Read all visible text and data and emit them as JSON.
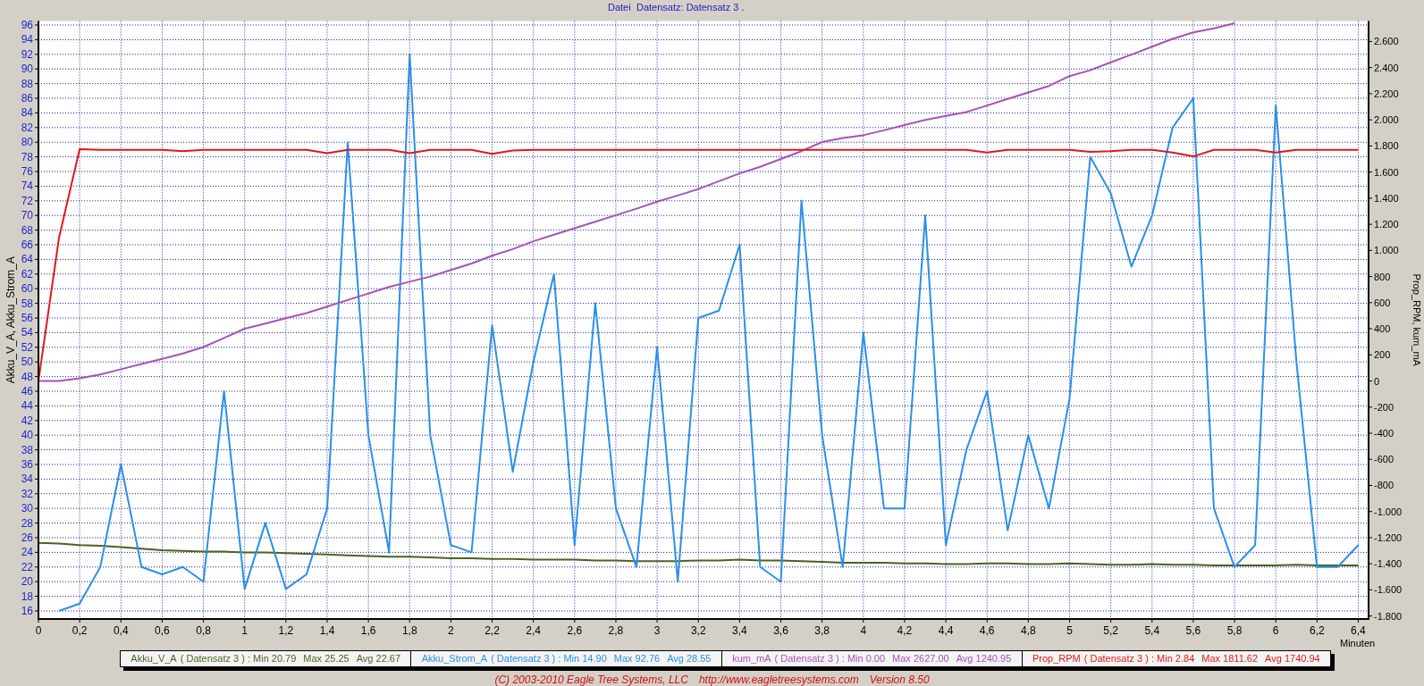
{
  "header": {
    "menu": "Datei",
    "title": "Datensatz: Datensatz 3 ."
  },
  "chart": {
    "chart_data": {
      "type": "line",
      "grid": true,
      "xlabel": "Minuten",
      "ylabel": "Akku_V_A, Akku_Strom_A",
      "y2label": "Prop_RPM, kum_mA",
      "xlim": [
        0,
        6.45
      ],
      "ylim": [
        14.9,
        96.55
      ],
      "y2lim": [
        -1823,
        2757
      ],
      "xticks": [
        0,
        {
          "value": 0.2,
          "label": "0,2"
        },
        {
          "value": 0.4,
          "label": "0,4"
        },
        {
          "value": 0.6,
          "label": "0,6"
        },
        {
          "value": 0.8,
          "label": "0,8"
        },
        1,
        {
          "value": 1.2,
          "label": "1,2"
        },
        {
          "value": 1.4,
          "label": "1,4"
        },
        {
          "value": 1.6,
          "label": "1,6"
        },
        {
          "value": 1.8,
          "label": "1,8"
        },
        2,
        {
          "value": 2.2,
          "label": "2,2"
        },
        {
          "value": 2.4,
          "label": "2,4"
        },
        {
          "value": 2.6,
          "label": "2,6"
        },
        {
          "value": 2.8,
          "label": "2,8"
        },
        3,
        {
          "value": 3.2,
          "label": "3,2"
        },
        {
          "value": 3.4,
          "label": "3,4"
        },
        {
          "value": 3.6,
          "label": "3,6"
        },
        {
          "value": 3.8,
          "label": "3,8"
        },
        4,
        {
          "value": 4.2,
          "label": "4,2"
        },
        {
          "value": 4.4,
          "label": "4,4"
        },
        {
          "value": 4.6,
          "label": "4,6"
        },
        {
          "value": 4.8,
          "label": "4,8"
        },
        5,
        {
          "value": 5.2,
          "label": "5,2"
        },
        {
          "value": 5.4,
          "label": "5,4"
        },
        {
          "value": 5.6,
          "label": "5,6"
        },
        {
          "value": 5.8,
          "label": "5,8"
        },
        6,
        {
          "value": 6.2,
          "label": "6,2"
        },
        {
          "value": 6.4,
          "label": "6,4"
        }
      ],
      "yticks": [
        16,
        18,
        20,
        22,
        24,
        26,
        28,
        30,
        32,
        34,
        36,
        38,
        40,
        42,
        44,
        46,
        48,
        50,
        52,
        54,
        56,
        58,
        60,
        62,
        64,
        66,
        68,
        70,
        72,
        74,
        76,
        78,
        80,
        82,
        84,
        86,
        88,
        90,
        92,
        94,
        96
      ],
      "y2ticks": [
        {
          "value": -1800,
          "label": "-1.800"
        },
        {
          "value": -1600,
          "label": "-1.600"
        },
        {
          "value": -1400,
          "label": "-1.400"
        },
        {
          "value": -1200,
          "label": "-1.200"
        },
        {
          "value": -1000,
          "label": "-1.000"
        },
        -800,
        -600,
        -400,
        -200,
        0,
        200,
        400,
        600,
        800,
        {
          "value": 1000,
          "label": "1.000"
        },
        {
          "value": 1200,
          "label": "1.200"
        },
        {
          "value": 1400,
          "label": "1.400"
        },
        {
          "value": 1600,
          "label": "1.600"
        },
        {
          "value": 1800,
          "label": "1.800"
        },
        {
          "value": 2000,
          "label": "2.000"
        },
        {
          "value": 2200,
          "label": "2.200"
        },
        {
          "value": 2400,
          "label": "2.400"
        },
        {
          "value": 2600,
          "label": "2.600"
        }
      ],
      "x": [
        0,
        0.1,
        0.2,
        0.3,
        0.4,
        0.5,
        0.6,
        0.7,
        0.8,
        0.9,
        1.0,
        1.1,
        1.2,
        1.3,
        1.4,
        1.5,
        1.6,
        1.7,
        1.8,
        1.9,
        2.0,
        2.1,
        2.2,
        2.3,
        2.4,
        2.5,
        2.6,
        2.7,
        2.8,
        2.9,
        3.0,
        3.1,
        3.2,
        3.3,
        3.4,
        3.5,
        3.6,
        3.7,
        3.8,
        3.9,
        4.0,
        4.1,
        4.2,
        4.3,
        4.4,
        4.5,
        4.6,
        4.7,
        4.8,
        4.9,
        5.0,
        5.1,
        5.2,
        5.3,
        5.4,
        5.5,
        5.6,
        5.7,
        5.8,
        5.9,
        6.0,
        6.1,
        6.2,
        6.3,
        6.4
      ],
      "series": [
        {
          "name": "Akku_V_A",
          "color": "#4a6320",
          "values": [
            25.3,
            25.2,
            25.0,
            24.9,
            24.7,
            24.5,
            24.3,
            24.2,
            24.1,
            24.1,
            24.0,
            24.0,
            23.9,
            23.8,
            23.7,
            23.6,
            23.5,
            23.4,
            23.4,
            23.3,
            23.2,
            23.2,
            23.1,
            23.1,
            23.0,
            23.0,
            23.0,
            22.9,
            22.9,
            22.8,
            22.8,
            22.8,
            22.9,
            22.9,
            23.0,
            22.9,
            22.9,
            22.8,
            22.7,
            22.6,
            22.6,
            22.6,
            22.5,
            22.5,
            22.4,
            22.4,
            22.5,
            22.5,
            22.4,
            22.4,
            22.5,
            22.4,
            22.3,
            22.3,
            22.4,
            22.3,
            22.3,
            22.2,
            22.2,
            22.2,
            22.2,
            22.3,
            22.2,
            22.2,
            22.2
          ]
        },
        {
          "name": "Akku_Strom_A",
          "color": "#2b8fe8",
          "values": [
            null,
            16,
            17,
            22,
            36,
            22,
            21,
            22,
            20,
            46,
            19,
            28,
            19,
            21,
            30,
            80,
            40,
            24,
            92,
            40,
            25,
            24,
            55,
            35,
            50,
            62,
            25,
            58,
            30,
            22,
            52,
            20,
            56,
            57,
            66,
            22,
            20,
            72,
            40,
            22,
            54,
            30,
            30,
            70,
            25,
            38,
            46,
            27,
            40,
            30,
            45,
            78,
            73,
            63,
            70,
            82,
            86,
            30,
            22,
            25,
            85,
            50,
            22,
            22,
            25
          ]
        },
        {
          "name": "kum_mA",
          "color": "#a652b8",
          "axis": "y2",
          "values": [
            0,
            0,
            20,
            50,
            90,
            130,
            170,
            210,
            260,
            330,
            400,
            440,
            480,
            520,
            570,
            620,
            670,
            720,
            760,
            800,
            850,
            900,
            960,
            1010,
            1070,
            1120,
            1170,
            1220,
            1270,
            1320,
            1373,
            1420,
            1470,
            1530,
            1590,
            1640,
            1700,
            1760,
            1830,
            1860,
            1882,
            1920,
            1960,
            2000,
            2030,
            2060,
            2110,
            2160,
            2210,
            2260,
            2335,
            2380,
            2440,
            2500,
            2560,
            2620,
            2670,
            2700,
            2740,
            null,
            null,
            null,
            null,
            null,
            null
          ]
        },
        {
          "name": "Prop_RPM",
          "color": "#e01818",
          "axis": "y2",
          "values": [
            0,
            1100,
            1775,
            1770,
            1770,
            1770,
            1770,
            1760,
            1770,
            1770,
            1770,
            1770,
            1770,
            1770,
            1745,
            1770,
            1770,
            1770,
            1745,
            1770,
            1770,
            1770,
            1740,
            1765,
            1770,
            1770,
            1770,
            1770,
            1770,
            1770,
            1770,
            1770,
            1770,
            1770,
            1770,
            1770,
            1770,
            1770,
            1770,
            1770,
            1770,
            1770,
            1770,
            1770,
            1770,
            1770,
            1750,
            1770,
            1770,
            1770,
            1770,
            1755,
            1760,
            1770,
            1770,
            1750,
            1720,
            1770,
            1770,
            1770,
            1750,
            1770,
            1770,
            1770,
            1770
          ]
        }
      ]
    }
  },
  "legend": [
    {
      "detail": "( Datensatz 3 ) : Min 20.79",
      "max": "Max 25.25",
      "avg": "Avg 22.67"
    },
    {
      "detail": "( Datensatz 3 ) : Min 14.90",
      "max": "Max 92.76",
      "avg": "Avg 28.55"
    },
    {
      "detail": "( Datensatz 3 ) : Min 0.00",
      "max": "Max 2627.00",
      "avg": "Avg 1240.95"
    },
    {
      "detail": "( Datensatz 3 ) : Min 2.84",
      "max": "Max 1811.62",
      "avg": "Avg 1740.94"
    }
  ],
  "footer": {
    "copyright": "(C) 2003-2010 Eagle Tree Systems, LLC",
    "url": "http://www.eagletreesystems.com",
    "version": "Version 8.50"
  }
}
